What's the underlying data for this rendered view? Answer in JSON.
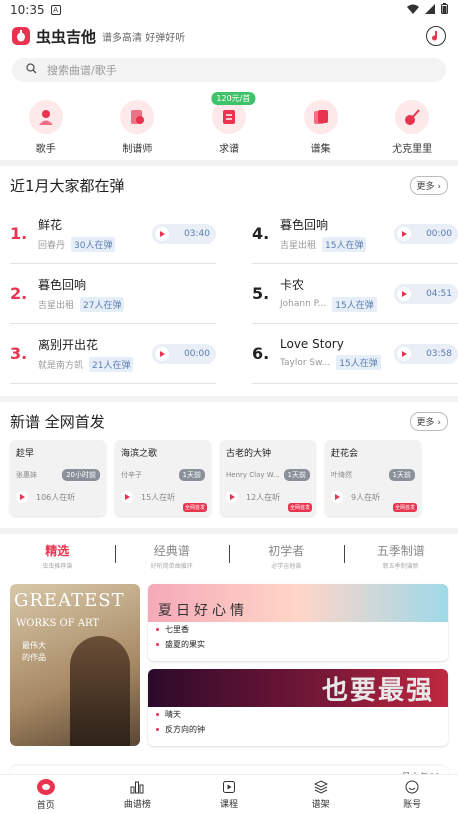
{
  "status": {
    "time": "10:35",
    "notif_icon": "a-icon"
  },
  "header": {
    "app_name": "虫虫吉他",
    "slogan": "谱多高清 好弹好听"
  },
  "search": {
    "placeholder": "搜索曲谱/歌手"
  },
  "categories": [
    {
      "label": "歌手",
      "icon": "singer-icon"
    },
    {
      "label": "制谱师",
      "icon": "transcriber-icon"
    },
    {
      "label": "求谱",
      "icon": "request-icon",
      "badge": "120元/首"
    },
    {
      "label": "谱集",
      "icon": "collection-icon"
    },
    {
      "label": "尤克里里",
      "icon": "ukulele-icon"
    }
  ],
  "recent": {
    "title": "近1月大家都在弹",
    "more": "更多",
    "items": [
      {
        "num": "1.",
        "title": "鲜花",
        "artist": "回春丹",
        "count": "30人在弹",
        "time": "03:40"
      },
      {
        "num": "4.",
        "title": "暮色回响",
        "artist": "吉星出租",
        "count": "15人在弹",
        "time": "00:00"
      },
      {
        "num": "2.",
        "title": "暮色回响",
        "artist": "吉星出租",
        "count": "27人在弹",
        "time": ""
      },
      {
        "num": "5.",
        "title": "卡农",
        "artist": "Johann P...",
        "count": "15人在弹",
        "time": "04:51"
      },
      {
        "num": "3.",
        "title": "离别开出花",
        "artist": "就是南方凯",
        "count": "21人在弹",
        "time": "00:00"
      },
      {
        "num": "6.",
        "title": "Love Story",
        "artist": "Taylor Sw...",
        "count": "15人在弹",
        "time": "03:58"
      }
    ]
  },
  "new_scores": {
    "title": "新谱 全网首发",
    "more": "更多",
    "cards": [
      {
        "title": "趁早",
        "artist": "张惠妹",
        "tag": "20小时前",
        "listen": "106人在听",
        "corner": ""
      },
      {
        "title": "海滨之歌",
        "artist": "付辛子",
        "tag": "1天前",
        "listen": "15人在听",
        "corner": "全网首发"
      },
      {
        "title": "古老的大钟",
        "artist": "Henry Clay W...",
        "tag": "1天前",
        "listen": "12人在听",
        "corner": "全网首发"
      },
      {
        "title": "赶花会",
        "artist": "叶绮然",
        "tag": "1天前",
        "listen": "9人在听",
        "corner": "全网首发"
      }
    ]
  },
  "tabs": [
    {
      "label": "精选",
      "sub": "虫虫推荐谱",
      "active": true
    },
    {
      "label": "经典谱",
      "sub": "好听简单曲循环",
      "active": false
    },
    {
      "label": "初学者",
      "sub": "必学吉他谱",
      "active": false
    },
    {
      "label": "五季制谱",
      "sub": "新五季制谱新",
      "active": false
    }
  ],
  "feature": {
    "cover_title": "GREATEST",
    "cover_sub": "WORKS OF ART",
    "cover_cn1": "最伟大",
    "cover_cn2": "的作品",
    "card1_banner": "夏日好心情",
    "card1_songs": [
      "七里香",
      "盛夏的果实"
    ],
    "card2_banner": "也要最强",
    "card2_songs": [
      "晴天",
      "反方向的钟"
    ]
  },
  "strip": {
    "text": "月人与68"
  },
  "nav": [
    {
      "label": "首页",
      "icon": "home-icon",
      "active": true
    },
    {
      "label": "曲谱榜",
      "icon": "chart-icon",
      "active": false
    },
    {
      "label": "课程",
      "icon": "course-icon",
      "active": false
    },
    {
      "label": "谱架",
      "icon": "stack-icon",
      "active": false
    },
    {
      "label": "账号",
      "icon": "account-icon",
      "active": false
    }
  ],
  "colors": {
    "accent": "#e8344e",
    "pill_bg": "#e6eef8",
    "pill_text": "#5b7eb0"
  }
}
